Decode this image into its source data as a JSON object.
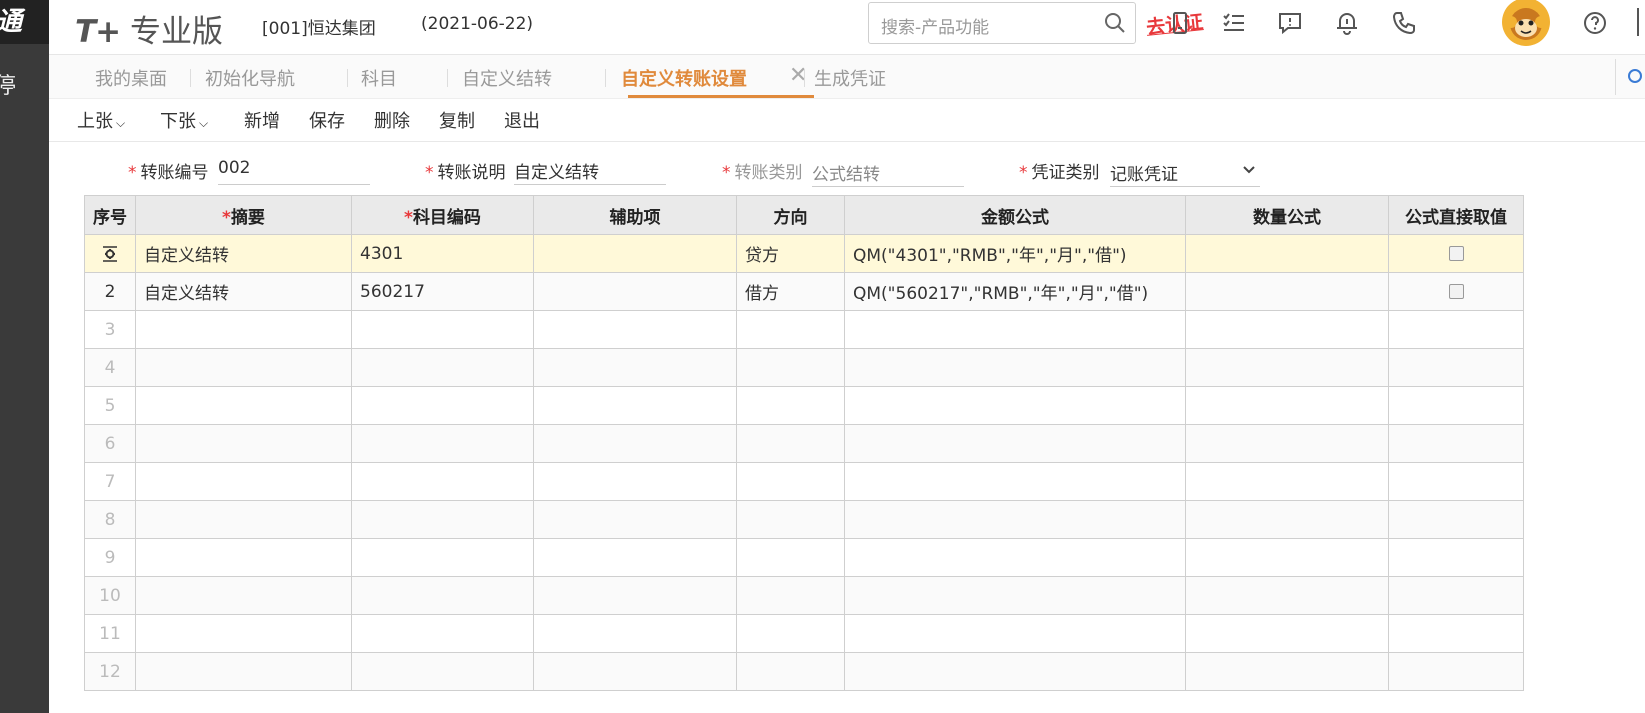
{
  "rail": {
    "title": "通",
    "item": "停"
  },
  "header": {
    "product_prefix": "T+",
    "product_name": "专业版",
    "company": "[001]恒达集团",
    "date": "(2021-06-22)",
    "search_placeholder": "搜索-产品功能",
    "cert_link": "去认证",
    "icons": [
      "search-icon",
      "mobile-icon",
      "task-list-icon",
      "message-icon",
      "bell-icon",
      "phone-icon",
      "avatar",
      "help-icon"
    ]
  },
  "tabs": [
    {
      "label": "我的桌面"
    },
    {
      "label": "初始化导航"
    },
    {
      "label": "科目"
    },
    {
      "label": "自定义结转"
    },
    {
      "label": "自定义转账设置",
      "active": true
    },
    {
      "label": "生成凭证"
    }
  ],
  "tab_close": "✕",
  "toolbar": {
    "prev": "上张",
    "next": "下张",
    "add": "新增",
    "save": "保存",
    "delete": "删除",
    "copy": "复制",
    "exit": "退出"
  },
  "form": {
    "required_mark": "*",
    "transfer_no_label": "转账编号",
    "transfer_no_value": "002",
    "transfer_desc_label": "转账说明",
    "transfer_desc_value": "自定义结转",
    "transfer_type_label": "转账类别",
    "transfer_type_value": "公式结转",
    "voucher_type_label": "凭证类别",
    "voucher_type_value": "记账凭证"
  },
  "table": {
    "headers": {
      "seq": "序号",
      "summary": "摘要",
      "account": "科目编码",
      "aux": "辅助项",
      "direction": "方向",
      "amount_formula": "金额公式",
      "qty_formula": "数量公式",
      "direct": "公式直接取值"
    },
    "rows": [
      {
        "seq": "",
        "summary": "自定义结转",
        "account": "4301",
        "aux": "",
        "direction": "贷方",
        "amount_formula": "QM(\"4301\",\"RMB\",\"年\",\"月\",\"借\")",
        "qty_formula": ""
      },
      {
        "seq": "2",
        "summary": "自定义结转",
        "account": "560217",
        "aux": "",
        "direction": "借方",
        "amount_formula": "QM(\"560217\",\"RMB\",\"年\",\"月\",\"借\")",
        "qty_formula": ""
      },
      {
        "seq": "3"
      },
      {
        "seq": "4"
      },
      {
        "seq": "5"
      },
      {
        "seq": "6"
      },
      {
        "seq": "7"
      },
      {
        "seq": "8"
      },
      {
        "seq": "9"
      },
      {
        "seq": "10"
      },
      {
        "seq": "11"
      },
      {
        "seq": "12"
      }
    ]
  },
  "colors": {
    "accent": "#e08a3c",
    "required": "#e8383b",
    "selected_row": "#fff9d9"
  }
}
